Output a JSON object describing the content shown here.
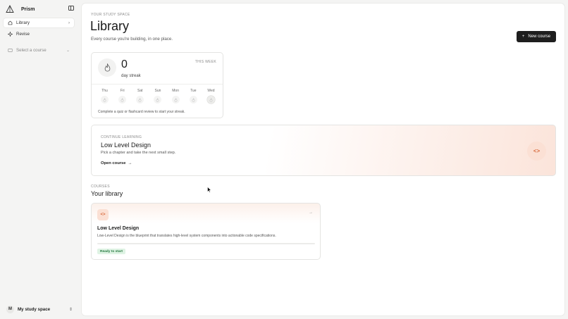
{
  "app": {
    "name": "Prism"
  },
  "sidebar": {
    "items": [
      {
        "label": "Library",
        "icon": "home-icon",
        "active": true
      },
      {
        "label": "Revise",
        "icon": "sparkle-icon",
        "active": false
      }
    ],
    "course_select": {
      "placeholder": "Select a course",
      "icon": "book-icon"
    },
    "workspace": {
      "initial": "M",
      "name": "My study space"
    }
  },
  "header": {
    "eyebrow": "YOUR STUDY SPACE",
    "title": "Library",
    "subtitle": "Every course you're building, in one place.",
    "new_course_label": "New course",
    "new_course_icon": "plus-icon"
  },
  "streak": {
    "count": "0",
    "label": "day streak",
    "period": "THIS WEEK",
    "days": [
      "Thu",
      "Fri",
      "Sat",
      "Sun",
      "Mon",
      "Tue",
      "Wed"
    ],
    "today_index": 6,
    "hint": "Complete a quiz or flashcard review to start your streak."
  },
  "continue": {
    "eyebrow": "CONTINUE LEARNING",
    "title": "Low Level Design",
    "description": "Pick a chapter and take the next small step.",
    "open_label": "Open course",
    "badge_icon": "code-icon"
  },
  "library": {
    "eyebrow": "COURSES",
    "title": "Your library",
    "courses": [
      {
        "title": "Low Level Design",
        "description": "Low-Level Design is the blueprint that translates high-level system components into actionable code specifications.",
        "progress": 0,
        "status": "Ready to start",
        "icon": "code-icon"
      }
    ]
  },
  "colors": {
    "accent": "#d86a3c",
    "accent_bg": "#fbe0d4",
    "primary_button": "#1e1e1e",
    "status_green": "#267a40",
    "status_green_bg": "#dff3e4"
  }
}
